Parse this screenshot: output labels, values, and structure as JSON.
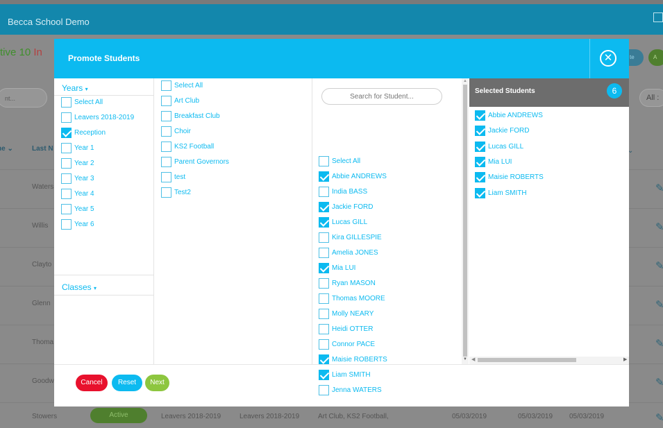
{
  "app": {
    "title": "Becca School Demo"
  },
  "background": {
    "status_active": "tive 10",
    "status_inactive": "In",
    "search_placeholder": "nt...",
    "all_filter": "All :",
    "pill1": "te",
    "pill2": "A",
    "col_first": "ne ⌄",
    "col_last": "Last N",
    "rows": [
      "Waters",
      "Willis",
      "Clayto",
      "Glenn",
      "Thoma",
      "Goodw"
    ],
    "last_row": {
      "name": "Stowers",
      "status": "Active",
      "year": "Leavers 2018-2019",
      "class": "Leavers 2018-2019",
      "groups": "Art Club, KS2 Football,",
      "date1": "05/03/2019",
      "date2": "05/03/2019",
      "date3": "05/03/2019"
    },
    "edit_icon": "pencil-icon"
  },
  "modal": {
    "title": "Promote Students",
    "close_icon": "close-circle-icon",
    "years": {
      "heading": "Years",
      "caret": "▾",
      "items": [
        {
          "label": "Select All",
          "checked": false
        },
        {
          "label": "Leavers 2018-2019",
          "checked": false
        },
        {
          "label": "Reception",
          "checked": true
        },
        {
          "label": "Year 1",
          "checked": false
        },
        {
          "label": "Year 2",
          "checked": false
        },
        {
          "label": "Year 3",
          "checked": false
        },
        {
          "label": "Year 4",
          "checked": false
        },
        {
          "label": "Year 5",
          "checked": false
        },
        {
          "label": "Year 6",
          "checked": false
        }
      ]
    },
    "classes": {
      "heading": "Classes",
      "caret": "▾"
    },
    "groups": {
      "items": [
        {
          "label": "Select All",
          "checked": false
        },
        {
          "label": "Art Club",
          "checked": false
        },
        {
          "label": "Breakfast Club",
          "checked": false
        },
        {
          "label": "Choir",
          "checked": false
        },
        {
          "label": "KS2 Football",
          "checked": false
        },
        {
          "label": "Parent Governors",
          "checked": false
        },
        {
          "label": "test",
          "checked": false
        },
        {
          "label": "Test2",
          "checked": false
        }
      ]
    },
    "students": {
      "search_placeholder": "Search for Student...",
      "items": [
        {
          "label": "Select All",
          "checked": false
        },
        {
          "label": "Abbie ANDREWS",
          "checked": true
        },
        {
          "label": "India BASS",
          "checked": false
        },
        {
          "label": "Jackie FORD",
          "checked": true
        },
        {
          "label": "Lucas GILL",
          "checked": true
        },
        {
          "label": "Kira GILLESPIE",
          "checked": false
        },
        {
          "label": "Amelia JONES",
          "checked": false
        },
        {
          "label": "Mia LUI",
          "checked": true
        },
        {
          "label": "Ryan MASON",
          "checked": false
        },
        {
          "label": "Thomas MOORE",
          "checked": false
        },
        {
          "label": "Molly NEARY",
          "checked": false
        },
        {
          "label": "Heidi OTTER",
          "checked": false
        },
        {
          "label": "Connor PACE",
          "checked": false
        },
        {
          "label": "Maisie ROBERTS",
          "checked": true
        },
        {
          "label": "Liam SMITH",
          "checked": true
        },
        {
          "label": "Jenna WATERS",
          "checked": false
        }
      ]
    },
    "selected": {
      "title": "Selected Students",
      "count": "6",
      "items": [
        {
          "label": "Abbie ANDREWS",
          "checked": true
        },
        {
          "label": "Jackie FORD",
          "checked": true
        },
        {
          "label": "Lucas GILL",
          "checked": true
        },
        {
          "label": "Mia LUI",
          "checked": true
        },
        {
          "label": "Maisie ROBERTS",
          "checked": true
        },
        {
          "label": "Liam SMITH",
          "checked": true
        }
      ]
    },
    "footer": {
      "cancel": "Cancel",
      "reset": "Reset",
      "next": "Next"
    },
    "colors": {
      "accent": "#0cbaf0",
      "cancel": "#e8112d",
      "next": "#8dc63f",
      "selected_header": "#6d6d6d"
    }
  }
}
